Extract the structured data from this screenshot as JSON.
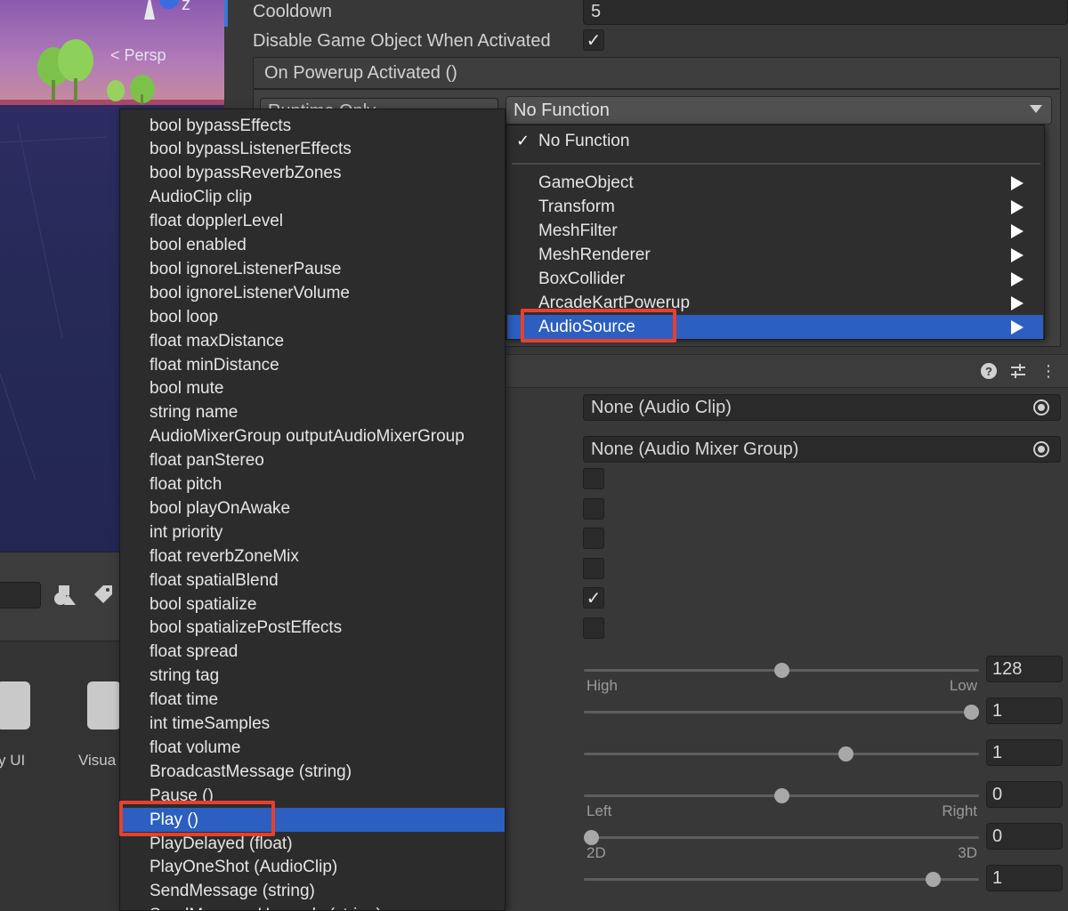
{
  "scene": {
    "view_mode_label": "< Persp",
    "axis_label": "z",
    "icons": [
      "axis-gizmo-icon",
      "tree-icon"
    ]
  },
  "project": {
    "tools": [
      "shapes-icon",
      "tag-icon"
    ],
    "asset_labels": [
      "y UI",
      "Visua"
    ]
  },
  "inspector": {
    "cooldown_label": "Cooldown",
    "cooldown_value": "5",
    "disable_label": "Disable Game Object When Activated",
    "disable_checked": true,
    "event_header": "On Powerup Activated ()",
    "runtime_label": "Runtime Only",
    "function_value": "No Function",
    "audio_clip_value": "None (Audio Clip)",
    "mixer_group_value": "None (Audio Mixer Group)",
    "checkboxes": [
      false,
      false,
      false,
      false,
      true,
      false
    ],
    "header_icons": [
      "help-icon",
      "presets-icon",
      "more-icon"
    ],
    "sliders": [
      {
        "value": "128",
        "fraction": 0.5,
        "left_label": "High",
        "right_label": "Low"
      },
      {
        "value": "1",
        "fraction": 1.0,
        "left_label": "",
        "right_label": ""
      },
      {
        "value": "1",
        "fraction": 0.67,
        "left_label": "",
        "right_label": ""
      },
      {
        "value": "0",
        "fraction": 0.5,
        "left_label": "Left",
        "right_label": "Right"
      },
      {
        "value": "0",
        "fraction": 0.0,
        "left_label": "2D",
        "right_label": "3D"
      },
      {
        "value": "1",
        "fraction": 0.9,
        "left_label": "",
        "right_label": ""
      }
    ]
  },
  "function_menu": {
    "checked_item": "No Function",
    "items": [
      "GameObject",
      "Transform",
      "MeshFilter",
      "MeshRenderer",
      "BoxCollider",
      "ArcadeKartPowerup",
      "AudioSource"
    ],
    "selected": "AudioSource"
  },
  "member_menu": {
    "items": [
      "bool bypassEffects",
      "bool bypassListenerEffects",
      "bool bypassReverbZones",
      "AudioClip clip",
      "float dopplerLevel",
      "bool enabled",
      "bool ignoreListenerPause",
      "bool ignoreListenerVolume",
      "bool loop",
      "float maxDistance",
      "float minDistance",
      "bool mute",
      "string name",
      "AudioMixerGroup outputAudioMixerGroup",
      "float panStereo",
      "float pitch",
      "bool playOnAwake",
      "int priority",
      "float reverbZoneMix",
      "float spatialBlend",
      "bool spatialize",
      "bool spatializePostEffects",
      "float spread",
      "string tag",
      "float time",
      "int timeSamples",
      "float volume",
      "BroadcastMessage (string)",
      "Pause ()",
      "Play ()",
      "PlayDelayed (float)",
      "PlayOneShot (AudioClip)",
      "SendMessage (string)",
      "SendMessageUpwards (string)"
    ],
    "selected": "Play ()"
  },
  "colors": {
    "selection": "#2c5fbf",
    "highlight": "#e8402e",
    "inspector_bg": "#383838",
    "menu_bg": "#2c2c2c"
  }
}
